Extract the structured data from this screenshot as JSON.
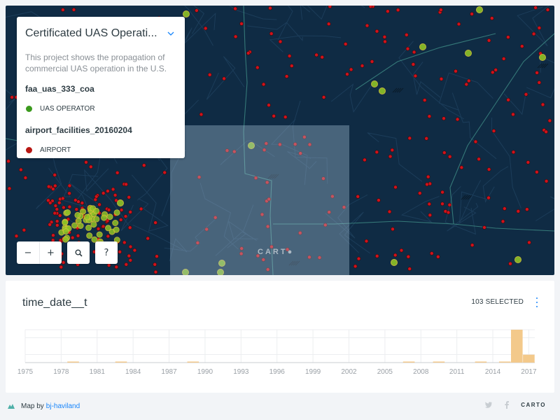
{
  "legend": {
    "title": "Certificated UAS Operati...",
    "description": "This project shows the propagation of commercial UAS operation in the U.S.",
    "layers": [
      {
        "name": "faa_uas_333_coa",
        "item_label": "UAS OPERATOR",
        "color": "#3c9a1e"
      },
      {
        "name": "airport_facilities_20160204",
        "item_label": "AIRPORT",
        "color": "#b81713"
      }
    ]
  },
  "map": {
    "watermark": "CART",
    "colors": {
      "background": "#0f2b44",
      "airport": "#d0121b",
      "operator": "#8fc325"
    }
  },
  "controls": {
    "zoom_out": "−",
    "zoom_in": "+",
    "search_icon": "search-icon",
    "help": "?"
  },
  "widget": {
    "title": "time_date__t",
    "selected": "103 SELECTED",
    "accent": "#1785fb",
    "bar_color": "#f3c98b"
  },
  "chart_data": {
    "type": "bar",
    "x_ticks": [
      "1975",
      "1978",
      "1981",
      "1984",
      "1987",
      "1990",
      "1993",
      "1996",
      "1999",
      "2002",
      "2005",
      "2008",
      "2011",
      "2014",
      "2017"
    ],
    "bins": [
      {
        "year": 1979,
        "value": 1
      },
      {
        "year": 1983,
        "value": 1
      },
      {
        "year": 1989,
        "value": 1
      },
      {
        "year": 2007,
        "value": 1
      },
      {
        "year": 2009.5,
        "value": 1
      },
      {
        "year": 2013,
        "value": 1
      },
      {
        "year": 2015,
        "value": 1
      },
      {
        "year": 2016,
        "value": 100
      },
      {
        "year": 2017,
        "value": 24
      }
    ],
    "ylim": [
      0,
      100
    ]
  },
  "footer": {
    "map_by": "Map by",
    "author": "bj-haviland",
    "carto": "CARTO"
  }
}
